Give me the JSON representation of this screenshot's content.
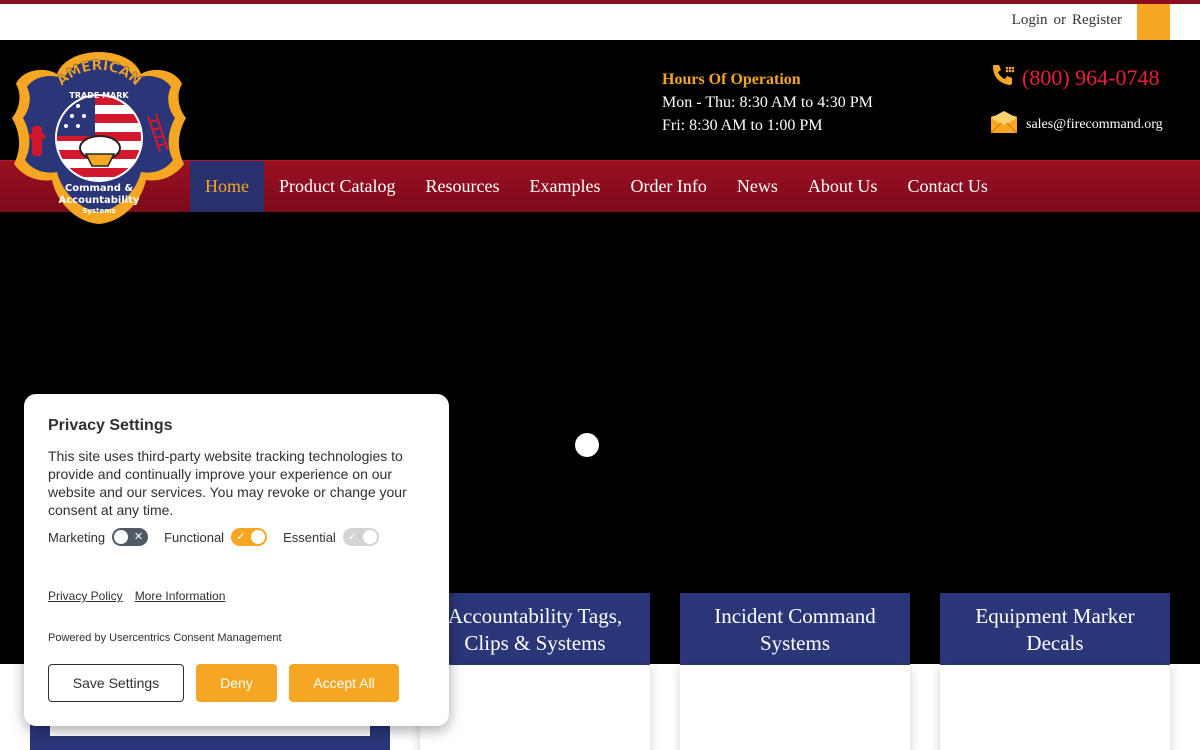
{
  "utility": {
    "login": "Login",
    "or": "or",
    "register": "Register"
  },
  "header": {
    "hours_title": "Hours Of Operation",
    "hours_line1": "Mon - Thu: 8:30 AM to 4:30 PM",
    "hours_line2": "Fri: 8:30 AM to 1:00 PM",
    "phone": "(800) 964-0748",
    "email": "sales@firecommand.org"
  },
  "logo": {
    "text_top": "AMERICAN",
    "text_top2": "TRADE MARK",
    "text_bottom": "Command &",
    "text_bottom2": "Accountability",
    "text_bottom3": "Systems"
  },
  "nav": {
    "items": [
      {
        "label": "Home",
        "active": true
      },
      {
        "label": "Product Catalog"
      },
      {
        "label": "Resources"
      },
      {
        "label": "Examples"
      },
      {
        "label": "Order Info"
      },
      {
        "label": "News"
      },
      {
        "label": "About Us"
      },
      {
        "label": "Contact Us"
      }
    ]
  },
  "cards": [
    {
      "title_line1": "Accountability Tags,",
      "title_line2": "Clips & Systems"
    },
    {
      "title_line1": "Incident Command",
      "title_line2": "Systems"
    },
    {
      "title_line1": "Equipment Marker",
      "title_line2": "Decals"
    }
  ],
  "privacy": {
    "title": "Privacy Settings",
    "text": "This site uses third-party website tracking technologies to provide and continually improve your experience on our website and our services. You may revoke or change your consent at any time.",
    "toggles": [
      {
        "label": "Marketing",
        "state": "off"
      },
      {
        "label": "Functional",
        "state": "on"
      },
      {
        "label": "Essential",
        "state": "disabled"
      }
    ],
    "policy_link": "Privacy Policy",
    "more_link": "More Information",
    "powered": "Powered by Usercentrics Consent Management",
    "btn_save": "Save Settings",
    "btn_deny": "Deny",
    "btn_accept": "Accept All"
  },
  "colors": {
    "brand_red": "#8b0e1e",
    "navy": "#2a3678",
    "accent": "#f5a623",
    "phone_red": "#e8203a"
  }
}
